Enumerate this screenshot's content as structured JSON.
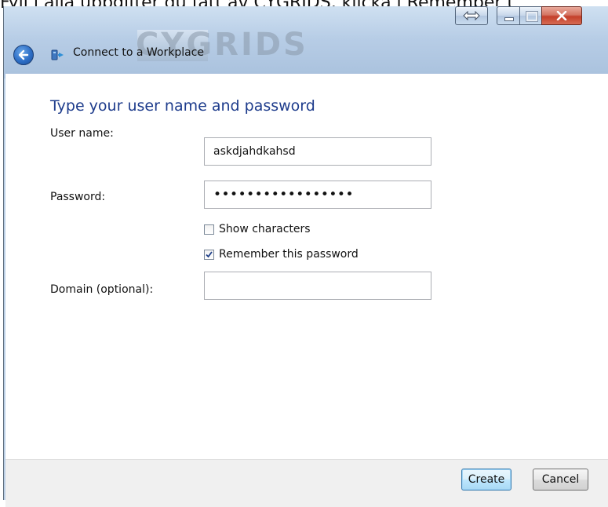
{
  "top_caption": "Fyll i alla uppgifter du fått av CYGRIDS, klicka i Remember t",
  "watermark": "CYGRIDS",
  "window": {
    "title": "Connect to a Workplace",
    "caption_buttons": [
      "restore-arrows",
      "minimize",
      "maximize",
      "close"
    ]
  },
  "form": {
    "heading": "Type your user name and password",
    "username_label": "User name:",
    "username_value": "askdjahdkahsd",
    "password_label": "Password:",
    "password_value": "•••••••••••••••••",
    "show_characters_label": "Show characters",
    "show_characters_checked": false,
    "remember_label": "Remember this password",
    "remember_checked": true,
    "domain_label": "Domain (optional):",
    "domain_value": ""
  },
  "footer": {
    "create_label": "Create",
    "cancel_label": "Cancel"
  },
  "icons": {
    "back": "back-arrow-icon",
    "app": "workplace-network-icon",
    "close": "close-icon",
    "minimize": "minimize-icon",
    "maximize": "maximize-icon",
    "arrows": "left-right-arrows-icon"
  },
  "colors": {
    "heading": "#1e3c8c",
    "aero_glass": "#b7cde6",
    "close_button": "#c43f2a",
    "footer": "#f0f0f0"
  }
}
